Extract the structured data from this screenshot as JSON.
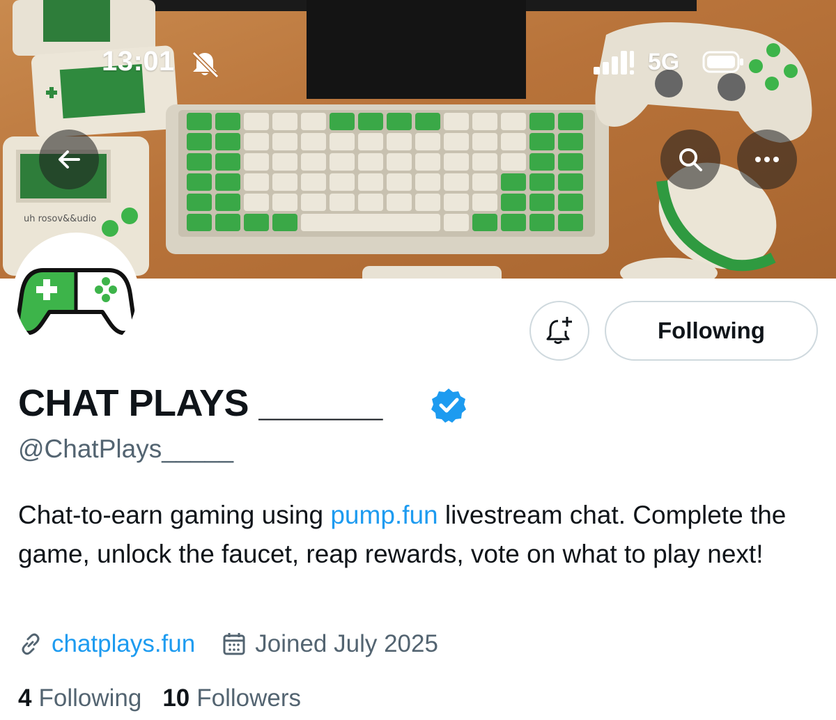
{
  "status_bar": {
    "time": "13:01",
    "network": "5G",
    "mute_icon": "bell-slash-icon",
    "signal_icon": "signal-bars-icon",
    "battery_icon": "battery-icon"
  },
  "header": {
    "back_icon": "arrow-left-icon",
    "search_icon": "search-icon",
    "more_icon": "ellipsis-icon"
  },
  "banner": {
    "description_icon": "gaming-setup-banner",
    "handheld_label": "uh rosov&&udio"
  },
  "profile": {
    "display_name": "CHAT PLAYS ______",
    "verified_icon": "verified-badge-icon",
    "handle": "@ChatPlays_____",
    "avatar_icon": "gamepad-logo-icon",
    "bio": {
      "part1": "Chat-to-earn gaming using ",
      "link": "pump.fun",
      "part2": " livestream chat. Complete the game, unlock the faucet, reap rewards, vote on what to play next!"
    },
    "website": "chatplays.fun",
    "website_icon": "link-icon",
    "joined": "Joined July 2025",
    "joined_icon": "calendar-icon"
  },
  "actions": {
    "notify_icon": "bell-plus-icon",
    "following_label": "Following"
  },
  "stats": {
    "following_count": "4",
    "following_label": "Following",
    "followers_count": "10",
    "followers_label": "Followers"
  },
  "colors": {
    "accent": "#1d9bf0",
    "text_primary": "#0f1419",
    "text_secondary": "#536471",
    "border": "#cfd9de",
    "brand_green": "#3db44a"
  }
}
